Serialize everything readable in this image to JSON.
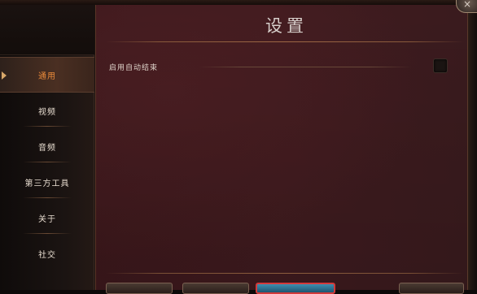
{
  "window": {
    "title": "设置",
    "close_glyph": "×"
  },
  "sidebar": {
    "items": [
      {
        "label": "通用",
        "active": true
      },
      {
        "label": "视频",
        "active": false
      },
      {
        "label": "音频",
        "active": false
      },
      {
        "label": "第三方工具",
        "active": false
      },
      {
        "label": "关于",
        "active": false
      },
      {
        "label": "社交",
        "active": false
      }
    ]
  },
  "settings": {
    "auto_end": {
      "label": "启用自动结束",
      "checked": false
    }
  },
  "colors": {
    "accent": "#e98a3a",
    "panel": "#3d181c",
    "highlight_border": "#d23a3a"
  },
  "icons": {
    "close": "close-icon",
    "active_marker": "caret-right-icon"
  }
}
